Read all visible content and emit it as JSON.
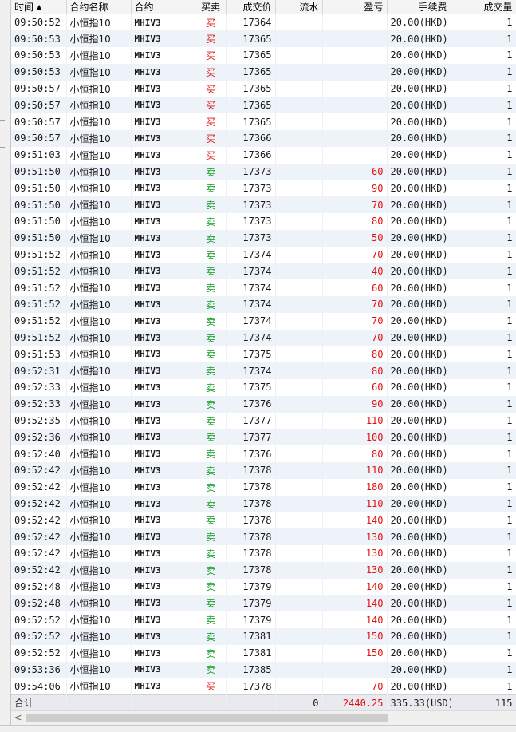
{
  "columns": {
    "time": "时间",
    "name": "合约名称",
    "code": "合约",
    "side": "买卖",
    "price": "成交价",
    "flow": "流水",
    "pnl": "盈亏",
    "fee": "手续费",
    "qty": "成交量",
    "sort_indicator": "▲"
  },
  "rows": [
    {
      "time": "09:50:52",
      "name": "小恒指10",
      "code": "MHIV3",
      "side": "买",
      "price": "17364",
      "flow": "",
      "pnl": "",
      "fee": "20.00(HKD)",
      "qty": "1"
    },
    {
      "time": "09:50:53",
      "name": "小恒指10",
      "code": "MHIV3",
      "side": "买",
      "price": "17365",
      "flow": "",
      "pnl": "",
      "fee": "20.00(HKD)",
      "qty": "1"
    },
    {
      "time": "09:50:53",
      "name": "小恒指10",
      "code": "MHIV3",
      "side": "买",
      "price": "17365",
      "flow": "",
      "pnl": "",
      "fee": "20.00(HKD)",
      "qty": "1"
    },
    {
      "time": "09:50:53",
      "name": "小恒指10",
      "code": "MHIV3",
      "side": "买",
      "price": "17365",
      "flow": "",
      "pnl": "",
      "fee": "20.00(HKD)",
      "qty": "1"
    },
    {
      "time": "09:50:57",
      "name": "小恒指10",
      "code": "MHIV3",
      "side": "买",
      "price": "17365",
      "flow": "",
      "pnl": "",
      "fee": "20.00(HKD)",
      "qty": "1"
    },
    {
      "time": "09:50:57",
      "name": "小恒指10",
      "code": "MHIV3",
      "side": "买",
      "price": "17365",
      "flow": "",
      "pnl": "",
      "fee": "20.00(HKD)",
      "qty": "1"
    },
    {
      "time": "09:50:57",
      "name": "小恒指10",
      "code": "MHIV3",
      "side": "买",
      "price": "17365",
      "flow": "",
      "pnl": "",
      "fee": "20.00(HKD)",
      "qty": "1"
    },
    {
      "time": "09:50:57",
      "name": "小恒指10",
      "code": "MHIV3",
      "side": "买",
      "price": "17366",
      "flow": "",
      "pnl": "",
      "fee": "20.00(HKD)",
      "qty": "1"
    },
    {
      "time": "09:51:03",
      "name": "小恒指10",
      "code": "MHIV3",
      "side": "买",
      "price": "17366",
      "flow": "",
      "pnl": "",
      "fee": "20.00(HKD)",
      "qty": "1"
    },
    {
      "time": "09:51:50",
      "name": "小恒指10",
      "code": "MHIV3",
      "side": "卖",
      "price": "17373",
      "flow": "",
      "pnl": "60",
      "fee": "20.00(HKD)",
      "qty": "1"
    },
    {
      "time": "09:51:50",
      "name": "小恒指10",
      "code": "MHIV3",
      "side": "卖",
      "price": "17373",
      "flow": "",
      "pnl": "90",
      "fee": "20.00(HKD)",
      "qty": "1"
    },
    {
      "time": "09:51:50",
      "name": "小恒指10",
      "code": "MHIV3",
      "side": "卖",
      "price": "17373",
      "flow": "",
      "pnl": "70",
      "fee": "20.00(HKD)",
      "qty": "1"
    },
    {
      "time": "09:51:50",
      "name": "小恒指10",
      "code": "MHIV3",
      "side": "卖",
      "price": "17373",
      "flow": "",
      "pnl": "80",
      "fee": "20.00(HKD)",
      "qty": "1"
    },
    {
      "time": "09:51:50",
      "name": "小恒指10",
      "code": "MHIV3",
      "side": "卖",
      "price": "17373",
      "flow": "",
      "pnl": "50",
      "fee": "20.00(HKD)",
      "qty": "1"
    },
    {
      "time": "09:51:52",
      "name": "小恒指10",
      "code": "MHIV3",
      "side": "卖",
      "price": "17374",
      "flow": "",
      "pnl": "70",
      "fee": "20.00(HKD)",
      "qty": "1"
    },
    {
      "time": "09:51:52",
      "name": "小恒指10",
      "code": "MHIV3",
      "side": "卖",
      "price": "17374",
      "flow": "",
      "pnl": "40",
      "fee": "20.00(HKD)",
      "qty": "1"
    },
    {
      "time": "09:51:52",
      "name": "小恒指10",
      "code": "MHIV3",
      "side": "卖",
      "price": "17374",
      "flow": "",
      "pnl": "60",
      "fee": "20.00(HKD)",
      "qty": "1"
    },
    {
      "time": "09:51:52",
      "name": "小恒指10",
      "code": "MHIV3",
      "side": "卖",
      "price": "17374",
      "flow": "",
      "pnl": "70",
      "fee": "20.00(HKD)",
      "qty": "1"
    },
    {
      "time": "09:51:52",
      "name": "小恒指10",
      "code": "MHIV3",
      "side": "卖",
      "price": "17374",
      "flow": "",
      "pnl": "70",
      "fee": "20.00(HKD)",
      "qty": "1"
    },
    {
      "time": "09:51:52",
      "name": "小恒指10",
      "code": "MHIV3",
      "side": "卖",
      "price": "17374",
      "flow": "",
      "pnl": "70",
      "fee": "20.00(HKD)",
      "qty": "1"
    },
    {
      "time": "09:51:53",
      "name": "小恒指10",
      "code": "MHIV3",
      "side": "卖",
      "price": "17375",
      "flow": "",
      "pnl": "80",
      "fee": "20.00(HKD)",
      "qty": "1"
    },
    {
      "time": "09:52:31",
      "name": "小恒指10",
      "code": "MHIV3",
      "side": "卖",
      "price": "17374",
      "flow": "",
      "pnl": "80",
      "fee": "20.00(HKD)",
      "qty": "1"
    },
    {
      "time": "09:52:33",
      "name": "小恒指10",
      "code": "MHIV3",
      "side": "卖",
      "price": "17375",
      "flow": "",
      "pnl": "60",
      "fee": "20.00(HKD)",
      "qty": "1"
    },
    {
      "time": "09:52:33",
      "name": "小恒指10",
      "code": "MHIV3",
      "side": "卖",
      "price": "17376",
      "flow": "",
      "pnl": "90",
      "fee": "20.00(HKD)",
      "qty": "1"
    },
    {
      "time": "09:52:35",
      "name": "小恒指10",
      "code": "MHIV3",
      "side": "卖",
      "price": "17377",
      "flow": "",
      "pnl": "110",
      "fee": "20.00(HKD)",
      "qty": "1"
    },
    {
      "time": "09:52:36",
      "name": "小恒指10",
      "code": "MHIV3",
      "side": "卖",
      "price": "17377",
      "flow": "",
      "pnl": "100",
      "fee": "20.00(HKD)",
      "qty": "1"
    },
    {
      "time": "09:52:40",
      "name": "小恒指10",
      "code": "MHIV3",
      "side": "卖",
      "price": "17376",
      "flow": "",
      "pnl": "80",
      "fee": "20.00(HKD)",
      "qty": "1"
    },
    {
      "time": "09:52:42",
      "name": "小恒指10",
      "code": "MHIV3",
      "side": "卖",
      "price": "17378",
      "flow": "",
      "pnl": "110",
      "fee": "20.00(HKD)",
      "qty": "1"
    },
    {
      "time": "09:52:42",
      "name": "小恒指10",
      "code": "MHIV3",
      "side": "卖",
      "price": "17378",
      "flow": "",
      "pnl": "180",
      "fee": "20.00(HKD)",
      "qty": "1"
    },
    {
      "time": "09:52:42",
      "name": "小恒指10",
      "code": "MHIV3",
      "side": "卖",
      "price": "17378",
      "flow": "",
      "pnl": "110",
      "fee": "20.00(HKD)",
      "qty": "1"
    },
    {
      "time": "09:52:42",
      "name": "小恒指10",
      "code": "MHIV3",
      "side": "卖",
      "price": "17378",
      "flow": "",
      "pnl": "140",
      "fee": "20.00(HKD)",
      "qty": "1"
    },
    {
      "time": "09:52:42",
      "name": "小恒指10",
      "code": "MHIV3",
      "side": "卖",
      "price": "17378",
      "flow": "",
      "pnl": "130",
      "fee": "20.00(HKD)",
      "qty": "1"
    },
    {
      "time": "09:52:42",
      "name": "小恒指10",
      "code": "MHIV3",
      "side": "卖",
      "price": "17378",
      "flow": "",
      "pnl": "130",
      "fee": "20.00(HKD)",
      "qty": "1"
    },
    {
      "time": "09:52:42",
      "name": "小恒指10",
      "code": "MHIV3",
      "side": "卖",
      "price": "17378",
      "flow": "",
      "pnl": "130",
      "fee": "20.00(HKD)",
      "qty": "1"
    },
    {
      "time": "09:52:48",
      "name": "小恒指10",
      "code": "MHIV3",
      "side": "卖",
      "price": "17379",
      "flow": "",
      "pnl": "140",
      "fee": "20.00(HKD)",
      "qty": "1"
    },
    {
      "time": "09:52:48",
      "name": "小恒指10",
      "code": "MHIV3",
      "side": "卖",
      "price": "17379",
      "flow": "",
      "pnl": "140",
      "fee": "20.00(HKD)",
      "qty": "1"
    },
    {
      "time": "09:52:52",
      "name": "小恒指10",
      "code": "MHIV3",
      "side": "卖",
      "price": "17379",
      "flow": "",
      "pnl": "140",
      "fee": "20.00(HKD)",
      "qty": "1"
    },
    {
      "time": "09:52:52",
      "name": "小恒指10",
      "code": "MHIV3",
      "side": "卖",
      "price": "17381",
      "flow": "",
      "pnl": "150",
      "fee": "20.00(HKD)",
      "qty": "1"
    },
    {
      "time": "09:52:52",
      "name": "小恒指10",
      "code": "MHIV3",
      "side": "卖",
      "price": "17381",
      "flow": "",
      "pnl": "150",
      "fee": "20.00(HKD)",
      "qty": "1"
    },
    {
      "time": "09:53:36",
      "name": "小恒指10",
      "code": "MHIV3",
      "side": "卖",
      "price": "17385",
      "flow": "",
      "pnl": "",
      "fee": "20.00(HKD)",
      "qty": "1"
    },
    {
      "time": "09:54:06",
      "name": "小恒指10",
      "code": "MHIV3",
      "side": "买",
      "price": "17378",
      "flow": "",
      "pnl": "70",
      "fee": "20.00(HKD)",
      "qty": "1"
    }
  ],
  "totals": {
    "label": "合计",
    "flow": "0",
    "pnl": "2440.25",
    "fee": "335.33(USD)",
    "qty": "115"
  },
  "side_colors": {
    "buy": "#e01010",
    "sell": "#0a9a1a"
  },
  "scrollbar": {
    "left_arrow": "<"
  }
}
